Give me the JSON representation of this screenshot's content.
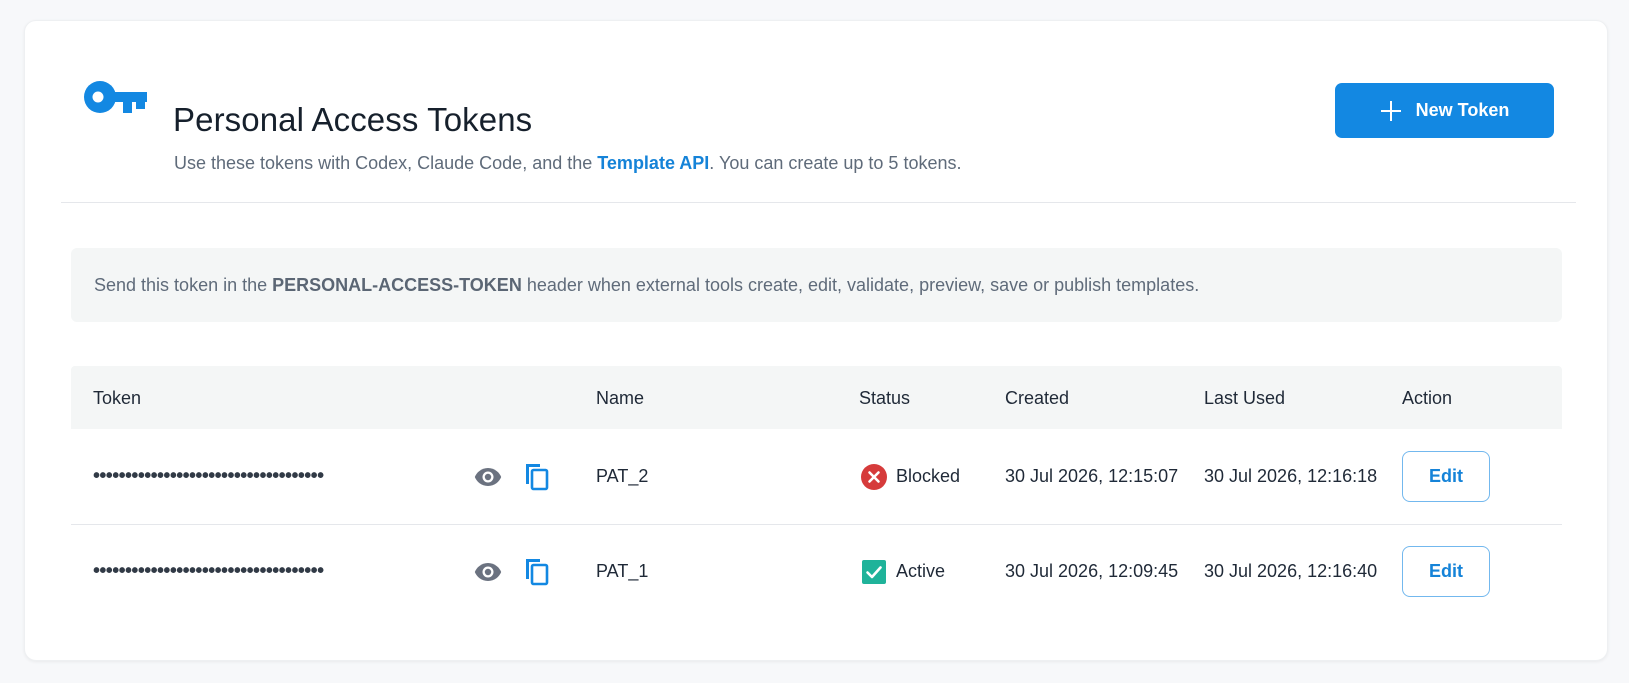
{
  "header": {
    "title": "Personal Access Tokens",
    "subtitle_prefix": "Use these tokens with Codex, Claude Code, and the ",
    "subtitle_link": "Template API",
    "subtitle_suffix": ". You can create up to 5 tokens.",
    "new_token_label": "New Token",
    "icon": "key-icon"
  },
  "info": {
    "prefix": "Send this token in the",
    "header_name": "PERSONAL-ACCESS-TOKEN",
    "suffix": "header when external tools create, edit, validate, preview, save or publish templates."
  },
  "table": {
    "columns": {
      "token": "Token",
      "name": "Name",
      "status": "Status",
      "created": "Created",
      "last_used": "Last Used",
      "action": "Action"
    },
    "rows": [
      {
        "token": "••••••••••••••••••••••••••••••••••••",
        "name": "PAT_2",
        "status": "Blocked",
        "status_icon": "x-circle-icon",
        "created": "30 Jul 2026, 12:15:07",
        "last_used": "30 Jul 2026, 12:16:18",
        "action": "Edit"
      },
      {
        "token": "••••••••••••••••••••••••••••••••••••",
        "name": "PAT_1",
        "status": "Active",
        "status_icon": "check-square-icon",
        "created": "30 Jul 2026, 12:09:45",
        "last_used": "30 Jul 2026, 12:16:40",
        "action": "Edit"
      }
    ]
  },
  "colors": {
    "accent": "#1388e2",
    "blocked": "#d63b3b",
    "active": "#1fb39a"
  }
}
